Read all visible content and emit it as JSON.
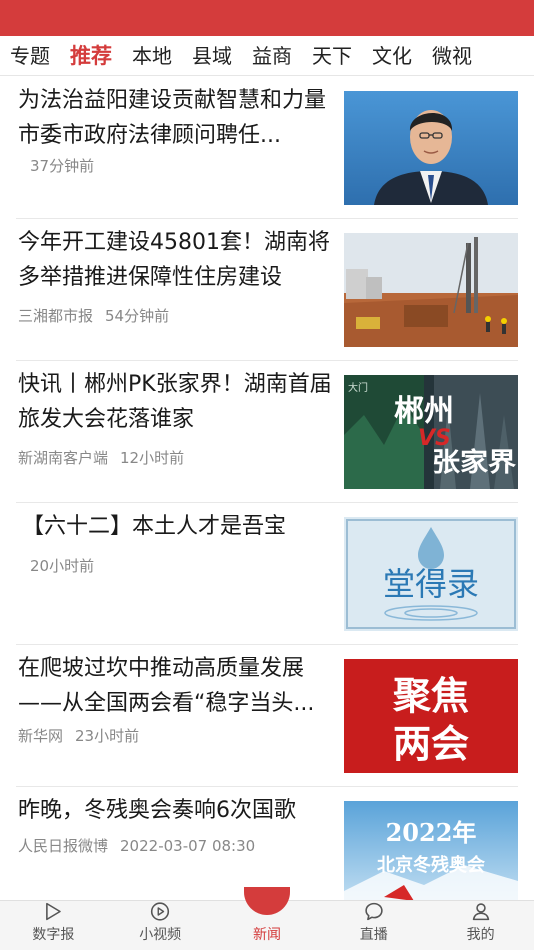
{
  "colors": {
    "accent": "#d43c3c",
    "meta": "#888888",
    "text": "#1a1a1a"
  },
  "tabs": [
    {
      "label": "专题"
    },
    {
      "label": "推荐",
      "active": true
    },
    {
      "label": "本地"
    },
    {
      "label": "县域"
    },
    {
      "label": "益商"
    },
    {
      "label": "天下"
    },
    {
      "label": "文化"
    },
    {
      "label": "微视"
    }
  ],
  "news": [
    {
      "title": "为法治益阳建设贡献智慧和力量 市委市政府法律顾问聘任...",
      "source": "",
      "time": "37分钟前",
      "thumb": "portrait-photo"
    },
    {
      "title": "今年开工建设45801套！湖南将多举措推进保障性住房建设",
      "source": "三湘都市报",
      "time": "54分钟前",
      "thumb": "construction-site-photo"
    },
    {
      "title": "快讯丨郴州PK张家界！湖南首届旅发大会花落谁家",
      "source": "新湖南客户端",
      "time": "12小时前",
      "thumb": "chenzhou-vs-zhangjiajie-graphic",
      "thumb_text": {
        "left": "郴州",
        "vs": "VS",
        "right": "张家界",
        "tag": "大门"
      }
    },
    {
      "title": "【六十二】本土人才是吾宝",
      "source": "",
      "time": "20小时前",
      "thumb": "tangdelu-graphic",
      "thumb_text": {
        "main": "堂得录"
      }
    },
    {
      "title": "在爬坡过坎中推动高质量发展——从全国两会看“稳字当头...",
      "source": "新华网",
      "time": "23小时前",
      "thumb": "focus-two-sessions-graphic",
      "thumb_text": {
        "line1": "聚焦",
        "line2": "两会"
      }
    },
    {
      "title": "昨晚，冬残奥会奏响6次国歌",
      "source": "人民日报微博",
      "time": "2022-03-07 08:30",
      "thumb": "paralympics-graphic",
      "thumb_text": {
        "line1": "2022年",
        "line2": "北京冬残奥会"
      }
    }
  ],
  "bottom_nav": [
    {
      "label": "数字报",
      "icon": "play-triangle-icon"
    },
    {
      "label": "小视频",
      "icon": "video-circle-icon"
    },
    {
      "label": "新闻",
      "icon": "news-home-icon",
      "active": true
    },
    {
      "label": "直播",
      "icon": "chat-bubble-icon"
    },
    {
      "label": "我的",
      "icon": "person-icon"
    }
  ]
}
